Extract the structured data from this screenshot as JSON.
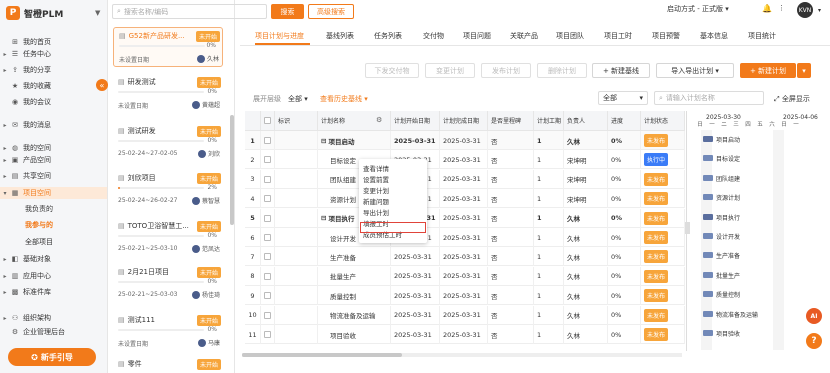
{
  "app": {
    "logo": "智橙PLM",
    "logo_mark": "P"
  },
  "sidebar": {
    "items": [
      {
        "label": "我的首页",
        "icon": "⊞"
      },
      {
        "label": "任务中心",
        "icon": "☰"
      },
      {
        "label": "我的分享",
        "icon": "⇪"
      },
      {
        "label": "我的收藏",
        "icon": "★"
      },
      {
        "label": "我的会议",
        "icon": "◉"
      },
      {
        "label": "我的消息",
        "icon": "✉"
      },
      {
        "label": "我的空间",
        "icon": "◍"
      },
      {
        "label": "产品空间",
        "icon": "▣"
      },
      {
        "label": "共享空间",
        "icon": "▤"
      },
      {
        "label": "项目空间",
        "icon": "▦"
      },
      {
        "label": "基础对象",
        "icon": "◧"
      },
      {
        "label": "应用中心",
        "icon": "▥"
      },
      {
        "label": "标准件库",
        "icon": "▩"
      },
      {
        "label": "组织架构",
        "icon": "⚇"
      },
      {
        "label": "企业管理后台",
        "icon": "⚙"
      }
    ],
    "sub_items": [
      "我负责的",
      "我参与的",
      "全部项目"
    ],
    "guide_button": "新手引导"
  },
  "search": {
    "placeholder": "搜索名称/编码",
    "search_button": "搜索",
    "advanced_button": "高级搜索"
  },
  "projects": [
    {
      "name": "G52新产品研发...",
      "status": "未开始",
      "progress": 0,
      "pct": "0%",
      "date": "未设置日期",
      "owner": "久林"
    },
    {
      "name": "研发测试",
      "status": "未开始",
      "progress": 0,
      "pct": "0%",
      "date": "未设置日期",
      "owner": "黄蕴超"
    },
    {
      "name": "测试研发",
      "status": "未开始",
      "progress": 0,
      "pct": "0%",
      "date": "25-02-24~27-02-05",
      "owner": "刘欣"
    },
    {
      "name": "刘欣项目",
      "status": "未开始",
      "progress": 2,
      "pct": "2%",
      "date": "25-02-24~26-02-27",
      "owner": "蔡智慧"
    },
    {
      "name": "TOTO卫浴智慧工...",
      "status": "未开始",
      "progress": 0,
      "pct": "0%",
      "date": "25-02-21~25-03-10",
      "owner": "范凤达"
    },
    {
      "name": "2月21日项目",
      "status": "未开始",
      "progress": 0,
      "pct": "0%",
      "date": "25-02-21~25-03-03",
      "owner": "杨佳琦"
    },
    {
      "name": "测试111",
      "status": "未开始",
      "progress": 0,
      "pct": "0%",
      "date": "未设置日期",
      "owner": "马康"
    },
    {
      "name": "零件",
      "status": "未开始",
      "progress": 0,
      "pct": "",
      "date": "",
      "owner": ""
    }
  ],
  "header": {
    "startup_mode": "启动方式 - 正式版",
    "avatar_text": "KVN"
  },
  "tabs": [
    "项目计划与进度",
    "基线列表",
    "任务列表",
    "交付物",
    "项目问题",
    "关联产品",
    "项目团队",
    "项目工时",
    "项目预警",
    "基本信息",
    "项目统计"
  ],
  "toolbar": {
    "deliver": "下发交付物",
    "change": "变更计划",
    "publish": "发布计划",
    "delete": "删除计划",
    "new_baseline": "新建基线",
    "import_export": "导入导出计划",
    "new_plan": "新建计划"
  },
  "filter": {
    "expand_label": "展开层级",
    "expand_value": "全部",
    "history": "查看历史基线",
    "all": "全部",
    "search_placeholder": "请输入计划名称",
    "fullscreen": "全屏显示"
  },
  "table": {
    "headers": [
      "",
      "",
      "标识",
      "计划名称",
      "计划开始日期",
      "计划完成日期",
      "是否里程碑",
      "计划工期",
      "负责人",
      "进度",
      "计划状态"
    ],
    "rows": [
      {
        "no": "1",
        "name": "项目启动",
        "start": "2025-03-31",
        "end": "2025-03-31",
        "ms": "否",
        "dur": "1",
        "owner": "久林",
        "pct": "0%",
        "status": "未发布",
        "bold": true,
        "prefix": "⊟"
      },
      {
        "no": "2",
        "name": "目标设定",
        "start": "2025-03-31",
        "end": "2025-03-31",
        "ms": "否",
        "dur": "1",
        "owner": "宋坤明",
        "pct": "0%",
        "status": "执行中",
        "bold": false,
        "prefix": ""
      },
      {
        "no": "3",
        "name": "团队组建",
        "start": "2025-03-31",
        "end": "2025-03-31",
        "ms": "否",
        "dur": "1",
        "owner": "宋坤明",
        "pct": "0%",
        "status": "未发布",
        "bold": false,
        "prefix": ""
      },
      {
        "no": "4",
        "name": "资源计划",
        "start": "2025-03-31",
        "end": "2025-03-31",
        "ms": "否",
        "dur": "1",
        "owner": "宋坤明",
        "pct": "0%",
        "status": "未发布",
        "bold": false,
        "prefix": ""
      },
      {
        "no": "5",
        "name": "项目执行",
        "start": "2025-03-31",
        "end": "2025-03-31",
        "ms": "否",
        "dur": "1",
        "owner": "久林",
        "pct": "0%",
        "status": "未发布",
        "bold": true,
        "prefix": "⊟"
      },
      {
        "no": "6",
        "name": "设计开发",
        "start": "2025-03-31",
        "end": "2025-03-31",
        "ms": "否",
        "dur": "1",
        "owner": "久林",
        "pct": "0%",
        "status": "未发布",
        "bold": false,
        "prefix": ""
      },
      {
        "no": "7",
        "name": "生产准备",
        "start": "2025-03-31",
        "end": "2025-03-31",
        "ms": "否",
        "dur": "1",
        "owner": "久林",
        "pct": "0%",
        "status": "未发布",
        "bold": false,
        "prefix": ""
      },
      {
        "no": "8",
        "name": "批量生产",
        "start": "2025-03-31",
        "end": "2025-03-31",
        "ms": "否",
        "dur": "1",
        "owner": "久林",
        "pct": "0%",
        "status": "未发布",
        "bold": false,
        "prefix": ""
      },
      {
        "no": "9",
        "name": "质量控制",
        "start": "2025-03-31",
        "end": "2025-03-31",
        "ms": "否",
        "dur": "1",
        "owner": "久林",
        "pct": "0%",
        "status": "未发布",
        "bold": false,
        "prefix": ""
      },
      {
        "no": "10",
        "name": "物流准备及运输",
        "start": "2025-03-31",
        "end": "2025-03-31",
        "ms": "否",
        "dur": "1",
        "owner": "久林",
        "pct": "0%",
        "status": "未发布",
        "bold": false,
        "prefix": ""
      },
      {
        "no": "11",
        "name": "项目验收",
        "start": "2025-03-31",
        "end": "2025-03-31",
        "ms": "否",
        "dur": "1",
        "owner": "久林",
        "pct": "0%",
        "status": "未发布",
        "bold": false,
        "prefix": ""
      }
    ]
  },
  "context_menu": [
    "查看详情",
    "设置前置",
    "变更计划",
    "新建问题",
    "导出计划",
    "填报工时",
    "成员预估工时"
  ],
  "gantt": {
    "date1": "2025-03-30",
    "date2": "2025-04-06",
    "days": [
      "日",
      "一",
      "二",
      "三",
      "四",
      "五",
      "六",
      "日",
      "一"
    ],
    "tasks": [
      "项目启动",
      "目标设定",
      "团队组建",
      "资源计划",
      "项目执行",
      "设计开发",
      "生产准备",
      "批量生产",
      "质量控制",
      "物流准备及运输",
      "项目验收"
    ]
  },
  "floating": {
    "ai": "AI",
    "help": "?"
  },
  "colors": {
    "accent": "#f27a1a",
    "status_orange": "#f7a53b",
    "status_blue": "#3b7cf7"
  }
}
